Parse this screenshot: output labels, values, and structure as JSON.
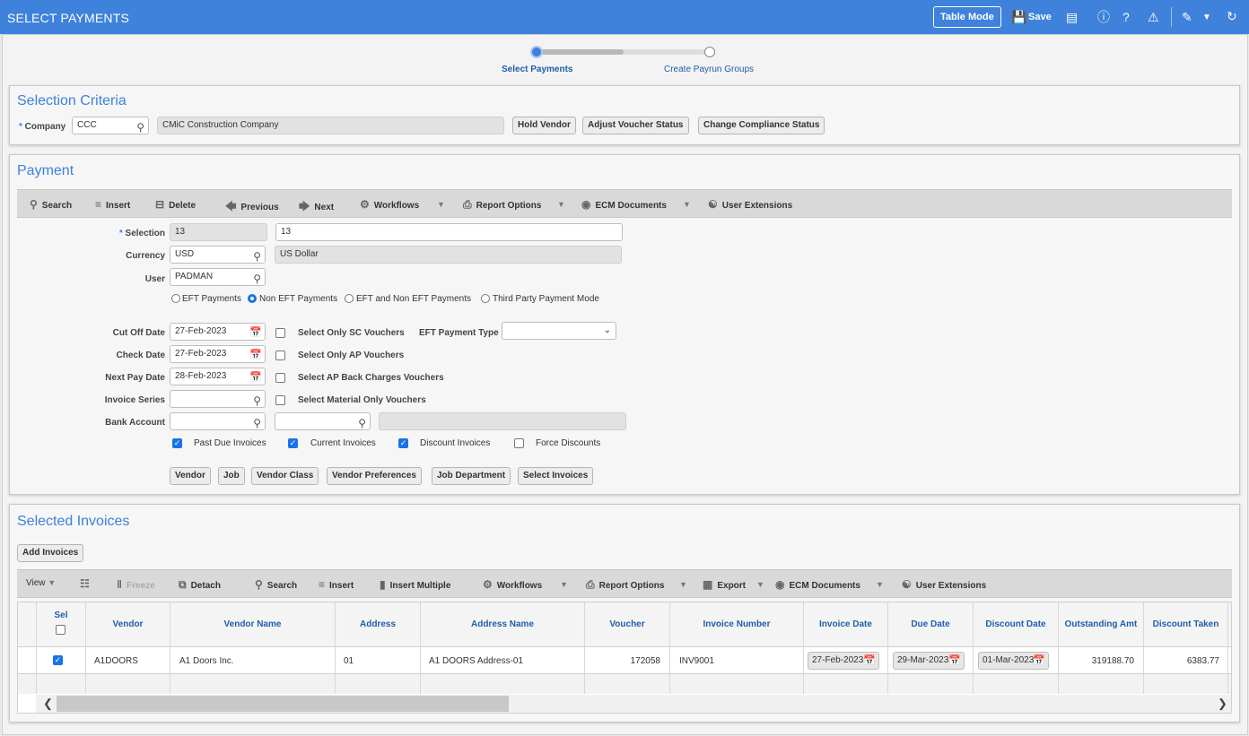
{
  "app": {
    "title": "SELECT PAYMENTS",
    "table_mode": "Table Mode",
    "save": "Save"
  },
  "steps": [
    {
      "label": "Select Payments",
      "active": true
    },
    {
      "label": "Create Payrun Groups",
      "active": false
    }
  ],
  "criteria": {
    "title": "Selection Criteria",
    "company_label": "Company",
    "company_value": "CCC",
    "company_name": "CMiC Construction Company",
    "buttons": [
      "Hold Vendor",
      "Adjust Voucher Status",
      "Change Compliance Status"
    ]
  },
  "payment": {
    "title": "Payment",
    "toolbar": [
      "Search",
      "Insert",
      "Delete",
      "Previous",
      "Next",
      "Workflows",
      "Report Options",
      "ECM Documents",
      "User Extensions"
    ],
    "selection_label": "Selection",
    "selection_code": "13",
    "selection_desc": "13",
    "currency_label": "Currency",
    "currency_code": "USD",
    "currency_name": "US Dollar",
    "user_label": "User",
    "user_value": "PADMAN",
    "modes": [
      "EFT Payments",
      "Non EFT Payments",
      "EFT and Non EFT Payments",
      "Third Party Payment Mode"
    ],
    "selected_mode": "Non EFT Payments",
    "cutoff_label": "Cut Off Date",
    "cutoff_value": "27-Feb-2023",
    "check_label": "Check Date",
    "check_value": "27-Feb-2023",
    "nextpay_label": "Next Pay Date",
    "nextpay_value": "28-Feb-2023",
    "invoice_series_label": "Invoice Series",
    "bank_label": "Bank Account",
    "opt_sc": "Select Only SC Vouchers",
    "opt_ap": "Select Only AP Vouchers",
    "opt_back": "Select AP Back Charges Vouchers",
    "opt_material": "Select Material Only Vouchers",
    "eft_type_label": "EFT Payment Type",
    "past_due": "Past Due Invoices",
    "current": "Current Invoices",
    "discount": "Discount Invoices",
    "force_discount": "Force Discounts",
    "filter_buttons": [
      "Vendor",
      "Job",
      "Vendor Class",
      "Vendor Preferences",
      "Job Department",
      "Select Invoices"
    ]
  },
  "invoices": {
    "title": "Selected Invoices",
    "add_button": "Add Invoices",
    "toolbar": [
      "View",
      "Freeze",
      "Detach",
      "Search",
      "Insert",
      "Insert Multiple",
      "Workflows",
      "Report Options",
      "Export",
      "ECM Documents",
      "User Extensions"
    ],
    "columns": [
      "Sel",
      "Vendor",
      "Vendor Name",
      "Address",
      "Address Name",
      "Voucher",
      "Invoice Number",
      "Invoice Date",
      "Due Date",
      "Discount Date",
      "Outstanding Amt",
      "Discount Taken"
    ],
    "rows": [
      {
        "vendor": "A1DOORS",
        "vendor_name": "A1 Doors Inc.",
        "address": "01",
        "address_name": "A1 DOORS Address-01",
        "voucher": "172058",
        "invoice_number": "INV9001",
        "invoice_date": "27-Feb-2023",
        "due_date": "29-Mar-2023",
        "discount_date": "01-Mar-2023",
        "outstanding": "319188.70",
        "discount_taken": "6383.77"
      }
    ]
  }
}
